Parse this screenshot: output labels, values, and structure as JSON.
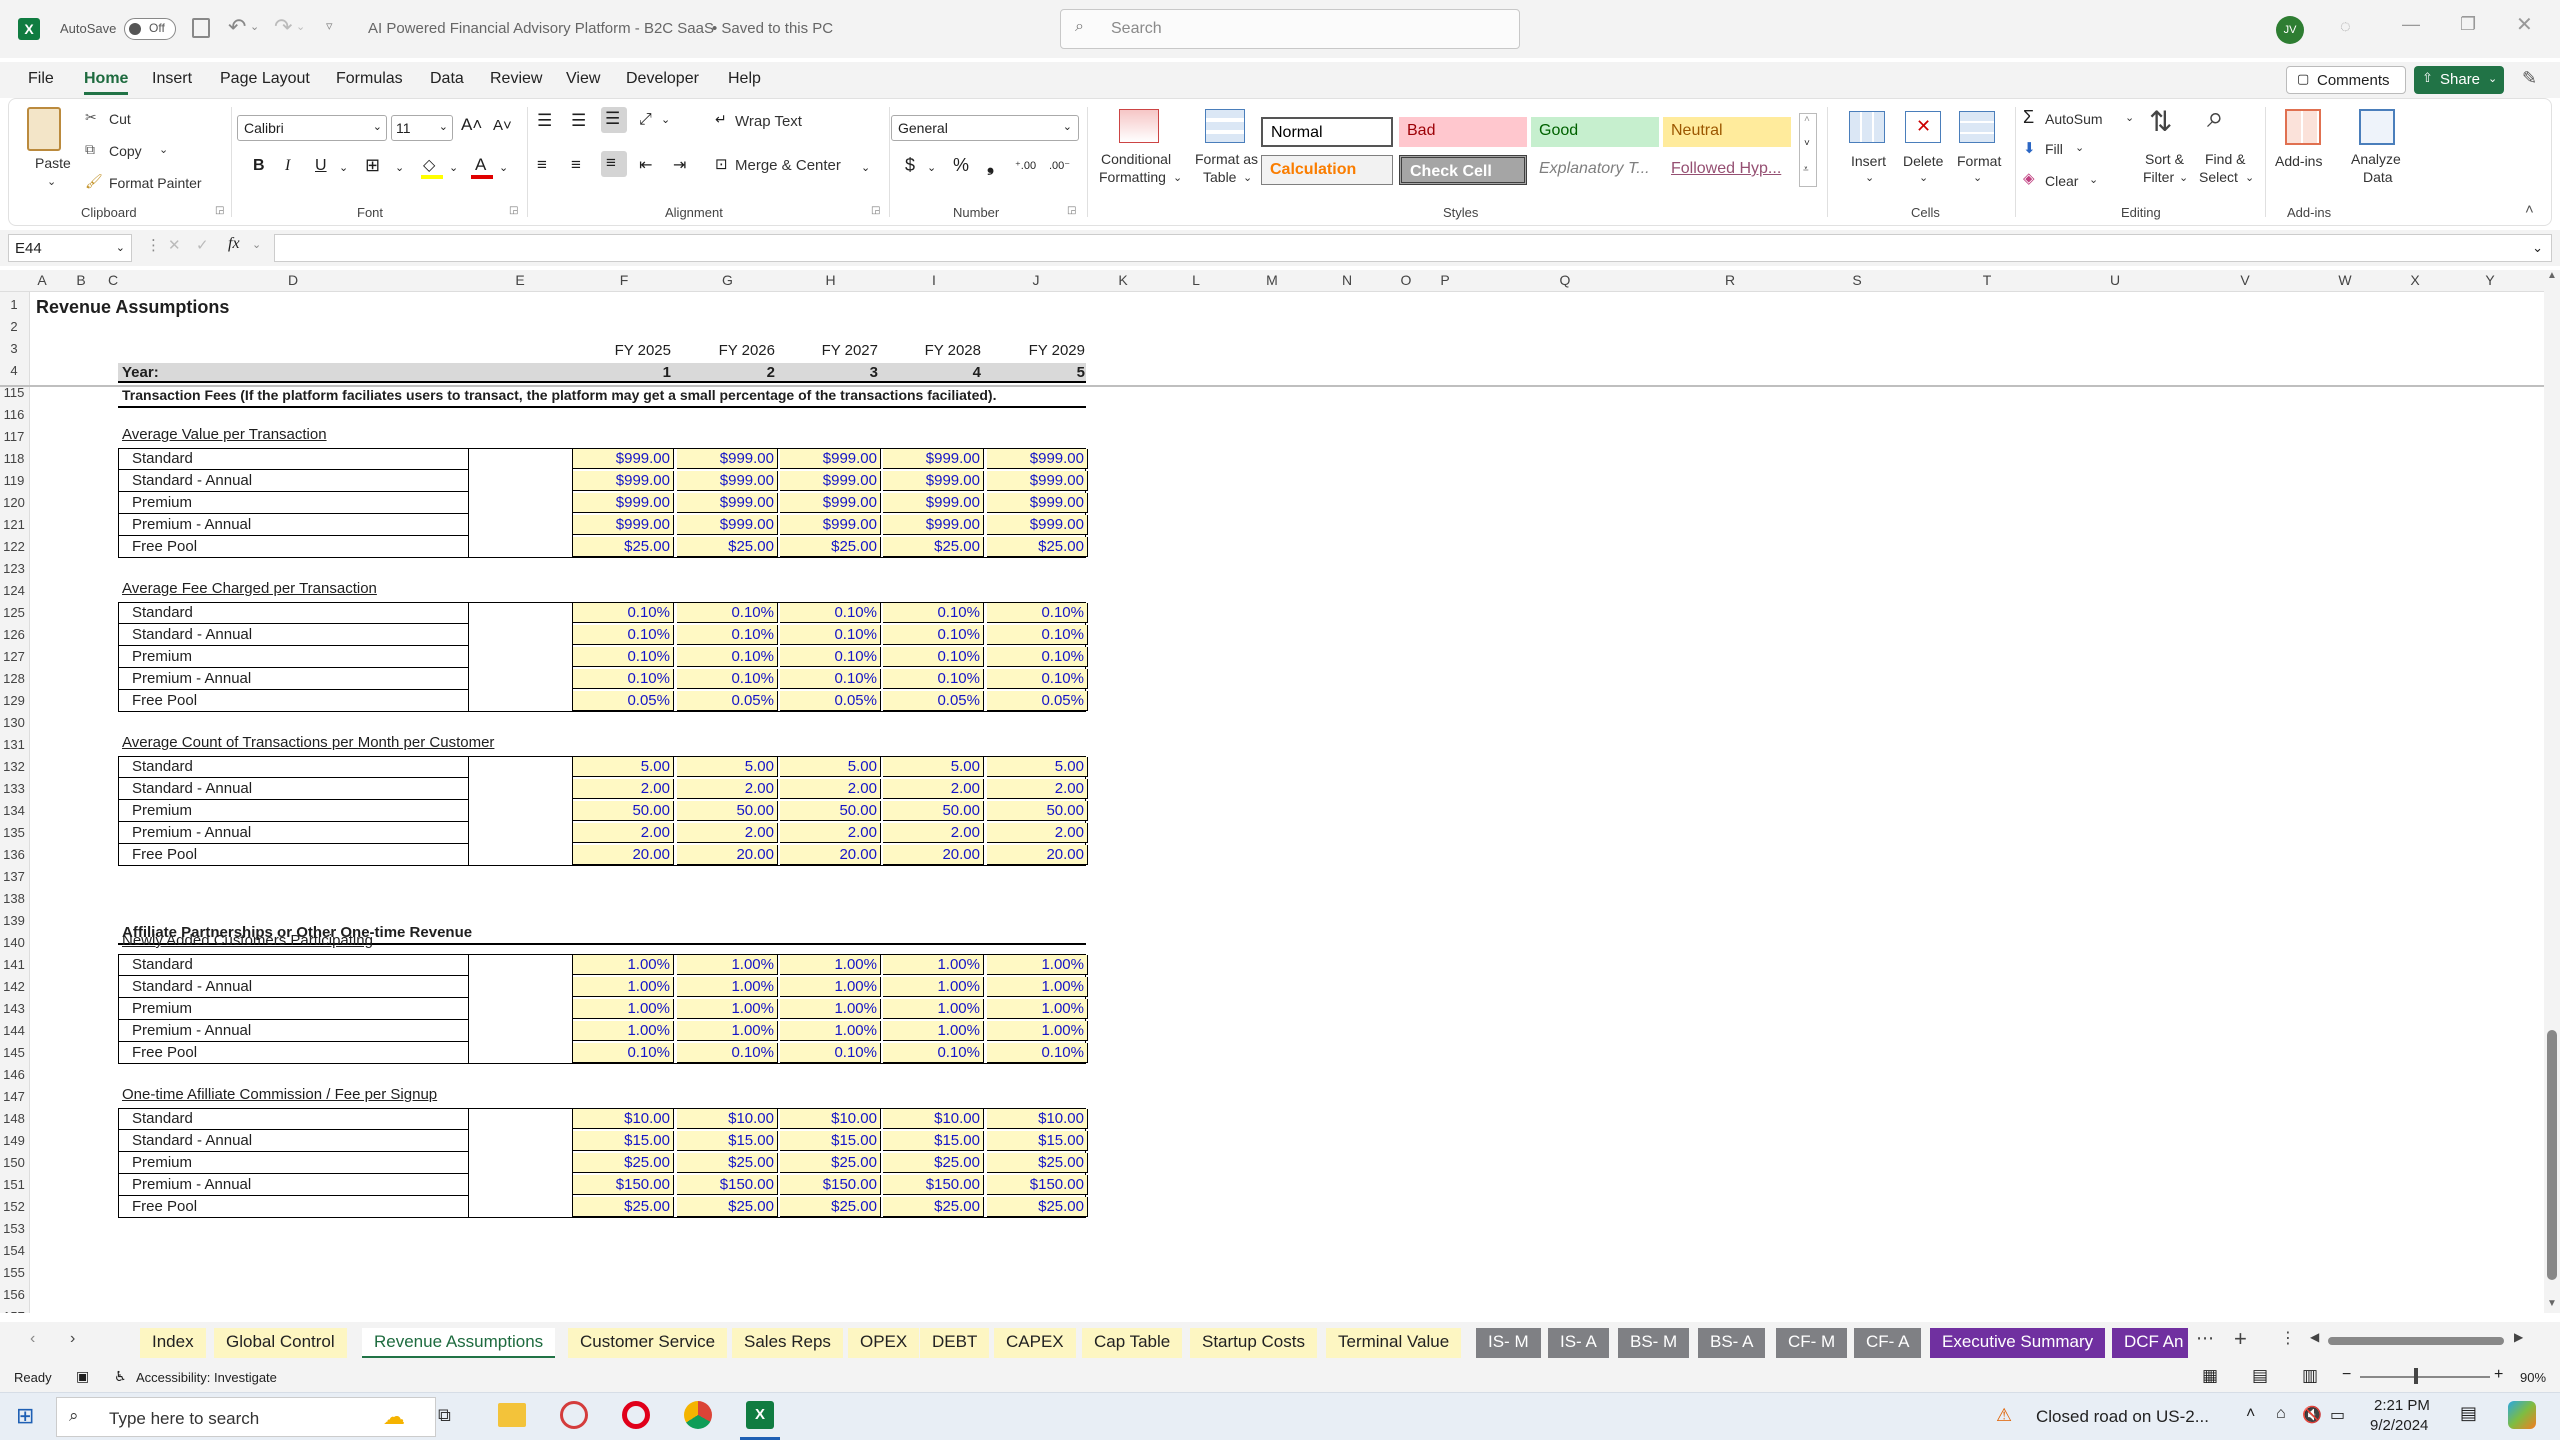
{
  "titlebar": {
    "autosave_label": "AutoSave",
    "autosave_state": "Off",
    "doc_title": "AI Powered Financial Advisory Platform - B2C SaaS",
    "save_state": "• Saved to this PC",
    "search_placeholder": "Search",
    "user_initials": "JV"
  },
  "menu": {
    "items": [
      "File",
      "Home",
      "Insert",
      "Page Layout",
      "Formulas",
      "Data",
      "Review",
      "View",
      "Developer",
      "Help"
    ],
    "active": "Home",
    "comments": "Comments",
    "share": "Share"
  },
  "ribbon": {
    "clipboard": {
      "paste": "Paste",
      "cut": "Cut",
      "copy": "Copy",
      "format_painter": "Format Painter",
      "label": "Clipboard"
    },
    "font": {
      "name": "Calibri",
      "size": "11",
      "label": "Font"
    },
    "alignment": {
      "wrap_text": "Wrap Text",
      "merge_center": "Merge & Center",
      "label": "Alignment"
    },
    "number": {
      "format": "General",
      "label": "Number"
    },
    "styles": {
      "conditional": "Conditional",
      "formatting": "Formatting",
      "format_as": "Format as",
      "table": "Table",
      "label": "Styles",
      "cells": [
        {
          "text": "Normal",
          "bg": "#ffffff",
          "color": "#000000"
        },
        {
          "text": "Bad",
          "bg": "#ffc7ce",
          "color": "#9c0006"
        },
        {
          "text": "Good",
          "bg": "#c6efce",
          "color": "#006100"
        },
        {
          "text": "Neutral",
          "bg": "#ffeb9c",
          "color": "#9c5700"
        },
        {
          "text": "Calculation",
          "bg": "#f2f2f2",
          "color": "#fa7d00"
        },
        {
          "text": "Check Cell",
          "bg": "#a5a5a5",
          "color": "#ffffff"
        },
        {
          "text": "Explanatory T...",
          "bg": "#ffffff",
          "color": "#7f7f7f"
        },
        {
          "text": "Followed Hyp...",
          "bg": "#ffffff",
          "color": "#954f72"
        }
      ]
    },
    "cells": {
      "insert": "Insert",
      "delete": "Delete",
      "format": "Format",
      "label": "Cells"
    },
    "editing": {
      "autosum": "AutoSum",
      "fill": "Fill",
      "clear": "Clear",
      "sort_filter_1": "Sort &",
      "sort_filter_2": "Filter",
      "find_select_1": "Find &",
      "find_select_2": "Select",
      "label": "Editing"
    },
    "addins": {
      "addins": "Add-ins",
      "analyze_1": "Analyze",
      "analyze_2": "Data",
      "label": "Add-ins"
    }
  },
  "formula_bar": {
    "name_box": "E44",
    "fx": "fx",
    "content": ""
  },
  "columns": [
    "A",
    "B",
    "C",
    "D",
    "E",
    "F",
    "G",
    "H",
    "I",
    "J",
    "K",
    "L",
    "M",
    "N",
    "O",
    "P",
    "Q",
    "R",
    "S",
    "T",
    "U",
    "V",
    "W",
    "X",
    "Y"
  ],
  "sheet": {
    "title": "Revenue Assumptions",
    "year_label": "Year:",
    "fiscal_years": [
      "FY 2025",
      "FY 2026",
      "FY 2027",
      "FY 2028",
      "FY 2029"
    ],
    "year_numbers": [
      "1",
      "2",
      "3",
      "4",
      "5"
    ],
    "row_numbers": [
      "1",
      "2",
      "3",
      "4",
      "115",
      "116",
      "117",
      "118",
      "119",
      "120",
      "121",
      "122",
      "123",
      "124",
      "125",
      "126",
      "127",
      "128",
      "129",
      "130",
      "131",
      "132",
      "133",
      "134",
      "135",
      "136",
      "137",
      "138",
      "139",
      "140",
      "141",
      "142",
      "143",
      "144",
      "145",
      "146",
      "147",
      "148",
      "149",
      "150",
      "151",
      "152",
      "153",
      "154",
      "155",
      "156",
      "157"
    ],
    "section1_header": "Transaction Fees (If the platform faciliates users to transact, the platform may get a small percentage of the transactions faciliated).",
    "section2_header": "Affiliate Partnerships or Other One-time Revenue",
    "blocks": [
      {
        "title": "Average Value per Transaction",
        "rows": [
          {
            "label": "Standard",
            "values": [
              "$999.00",
              "$999.00",
              "$999.00",
              "$999.00",
              "$999.00"
            ]
          },
          {
            "label": "Standard - Annual",
            "values": [
              "$999.00",
              "$999.00",
              "$999.00",
              "$999.00",
              "$999.00"
            ]
          },
          {
            "label": "Premium",
            "values": [
              "$999.00",
              "$999.00",
              "$999.00",
              "$999.00",
              "$999.00"
            ]
          },
          {
            "label": "Premium - Annual",
            "values": [
              "$999.00",
              "$999.00",
              "$999.00",
              "$999.00",
              "$999.00"
            ]
          },
          {
            "label": "Free Pool",
            "values": [
              "$25.00",
              "$25.00",
              "$25.00",
              "$25.00",
              "$25.00"
            ]
          }
        ]
      },
      {
        "title": "Average Fee Charged per Transaction",
        "rows": [
          {
            "label": "Standard",
            "values": [
              "0.10%",
              "0.10%",
              "0.10%",
              "0.10%",
              "0.10%"
            ]
          },
          {
            "label": "Standard - Annual",
            "values": [
              "0.10%",
              "0.10%",
              "0.10%",
              "0.10%",
              "0.10%"
            ]
          },
          {
            "label": "Premium",
            "values": [
              "0.10%",
              "0.10%",
              "0.10%",
              "0.10%",
              "0.10%"
            ]
          },
          {
            "label": "Premium - Annual",
            "values": [
              "0.10%",
              "0.10%",
              "0.10%",
              "0.10%",
              "0.10%"
            ]
          },
          {
            "label": "Free Pool",
            "values": [
              "0.05%",
              "0.05%",
              "0.05%",
              "0.05%",
              "0.05%"
            ]
          }
        ]
      },
      {
        "title": "Average Count of Transactions per Month per Customer",
        "rows": [
          {
            "label": "Standard",
            "values": [
              "5.00",
              "5.00",
              "5.00",
              "5.00",
              "5.00"
            ]
          },
          {
            "label": "Standard - Annual",
            "values": [
              "2.00",
              "2.00",
              "2.00",
              "2.00",
              "2.00"
            ]
          },
          {
            "label": "Premium",
            "values": [
              "50.00",
              "50.00",
              "50.00",
              "50.00",
              "50.00"
            ]
          },
          {
            "label": "Premium - Annual",
            "values": [
              "2.00",
              "2.00",
              "2.00",
              "2.00",
              "2.00"
            ]
          },
          {
            "label": "Free Pool",
            "values": [
              "20.00",
              "20.00",
              "20.00",
              "20.00",
              "20.00"
            ]
          }
        ]
      },
      {
        "title": "Newly Added Customers Participating",
        "rows": [
          {
            "label": "Standard",
            "values": [
              "1.00%",
              "1.00%",
              "1.00%",
              "1.00%",
              "1.00%"
            ]
          },
          {
            "label": "Standard - Annual",
            "values": [
              "1.00%",
              "1.00%",
              "1.00%",
              "1.00%",
              "1.00%"
            ]
          },
          {
            "label": "Premium",
            "values": [
              "1.00%",
              "1.00%",
              "1.00%",
              "1.00%",
              "1.00%"
            ]
          },
          {
            "label": "Premium - Annual",
            "values": [
              "1.00%",
              "1.00%",
              "1.00%",
              "1.00%",
              "1.00%"
            ]
          },
          {
            "label": "Free Pool",
            "values": [
              "0.10%",
              "0.10%",
              "0.10%",
              "0.10%",
              "0.10%"
            ]
          }
        ]
      },
      {
        "title": "One-time Afilliate Commission / Fee per Signup",
        "rows": [
          {
            "label": "Standard",
            "values": [
              "$10.00",
              "$10.00",
              "$10.00",
              "$10.00",
              "$10.00"
            ]
          },
          {
            "label": "Standard - Annual",
            "values": [
              "$15.00",
              "$15.00",
              "$15.00",
              "$15.00",
              "$15.00"
            ]
          },
          {
            "label": "Premium",
            "values": [
              "$25.00",
              "$25.00",
              "$25.00",
              "$25.00",
              "$25.00"
            ]
          },
          {
            "label": "Premium - Annual",
            "values": [
              "$150.00",
              "$150.00",
              "$150.00",
              "$150.00",
              "$150.00"
            ]
          },
          {
            "label": "Free Pool",
            "values": [
              "$25.00",
              "$25.00",
              "$25.00",
              "$25.00",
              "$25.00"
            ]
          }
        ]
      }
    ]
  },
  "tabs": [
    {
      "label": "Index",
      "style": "plain"
    },
    {
      "label": "Global Control",
      "style": "plain"
    },
    {
      "label": "Revenue Assumptions",
      "style": "active"
    },
    {
      "label": "Customer Service",
      "style": "plain"
    },
    {
      "label": "Sales Reps",
      "style": "plain"
    },
    {
      "label": "OPEX",
      "style": "plain"
    },
    {
      "label": "DEBT",
      "style": "plain"
    },
    {
      "label": "CAPEX",
      "style": "plain"
    },
    {
      "label": "Cap Table",
      "style": "plain"
    },
    {
      "label": "Startup Costs",
      "style": "plain"
    },
    {
      "label": "Terminal Value",
      "style": "plain"
    },
    {
      "label": "IS- M",
      "style": "grey"
    },
    {
      "label": "IS- A",
      "style": "grey"
    },
    {
      "label": "BS- M",
      "style": "grey"
    },
    {
      "label": "BS- A",
      "style": "grey"
    },
    {
      "label": "CF- M",
      "style": "grey"
    },
    {
      "label": "CF- A",
      "style": "grey"
    },
    {
      "label": "Executive Summary",
      "style": "purple"
    },
    {
      "label": "DCF An",
      "style": "purple"
    }
  ],
  "status": {
    "ready": "Ready",
    "accessibility": "Accessibility: Investigate",
    "zoom": "90%"
  },
  "taskbar": {
    "search_placeholder": "Type here to search",
    "notification": "Closed road on US-2...",
    "time": "2:21 PM",
    "date": "9/2/2024"
  }
}
